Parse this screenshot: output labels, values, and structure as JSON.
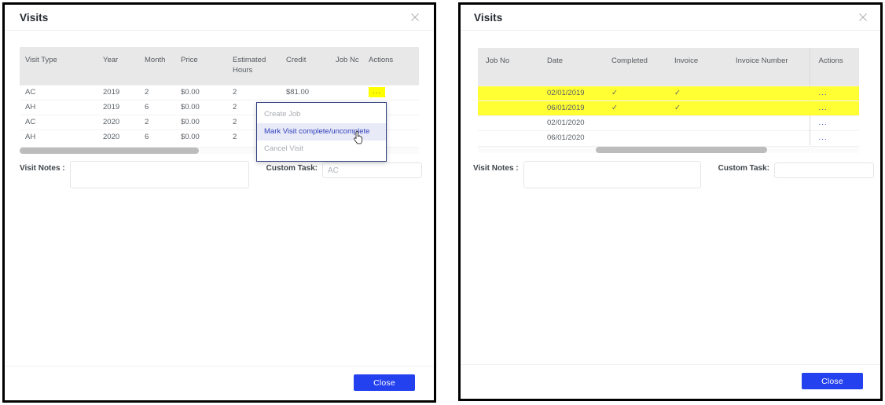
{
  "left_dialog": {
    "title": "Visits",
    "close_icon": "close-x-icon",
    "grid": {
      "headers": [
        "Visit Type",
        "Year",
        "Month",
        "Price",
        "Estimated Hours",
        "Credit",
        "Job No",
        "Actions"
      ],
      "header_job_no_clipped": "Job Nc",
      "rows": [
        {
          "visit_type": "AC",
          "year": "2019",
          "month": "2",
          "price": "$0.00",
          "estimated_hours": "2",
          "credit": "$81.00",
          "job_no": "",
          "actions": "..."
        },
        {
          "visit_type": "AH",
          "year": "2019",
          "month": "6",
          "price": "$0.00",
          "estimated_hours": "2",
          "credit": "",
          "job_no": "",
          "actions": "..."
        },
        {
          "visit_type": "AC",
          "year": "2020",
          "month": "2",
          "price": "$0.00",
          "estimated_hours": "2",
          "credit": "",
          "job_no": "",
          "actions": "..."
        },
        {
          "visit_type": "AH",
          "year": "2020",
          "month": "6",
          "price": "$0.00",
          "estimated_hours": "2",
          "credit": "",
          "job_no": "",
          "actions": "..."
        }
      ]
    },
    "context_menu": {
      "items": [
        {
          "label": "Create Job",
          "enabled": false
        },
        {
          "label": "Mark Visit complete/uncomplete",
          "enabled": true
        },
        {
          "label": "Cancel Visit",
          "enabled": false
        }
      ]
    },
    "visit_notes_label": "Visit Notes :",
    "visit_notes_value": "",
    "custom_task_label": "Custom Task:",
    "custom_task_value": "",
    "custom_task_placeholder": "AC",
    "close_button": "Close"
  },
  "right_dialog": {
    "title": "Visits",
    "close_icon": "close-x-icon",
    "grid": {
      "headers": [
        "Job No",
        "Date",
        "Completed",
        "Invoice",
        "Invoice Number",
        "Actions"
      ],
      "rows": [
        {
          "job_no": "",
          "date": "02/01/2019",
          "completed": "✓",
          "invoice": "✓",
          "invoice_number": "",
          "actions": "...",
          "highlighted": true
        },
        {
          "job_no": "",
          "date": "06/01/2019",
          "completed": "✓",
          "invoice": "✓",
          "invoice_number": "",
          "actions": "...",
          "highlighted": true
        },
        {
          "job_no": "",
          "date": "02/01/2020",
          "completed": "",
          "invoice": "",
          "invoice_number": "",
          "actions": "...",
          "highlighted": false
        },
        {
          "job_no": "",
          "date": "06/01/2020",
          "completed": "",
          "invoice": "",
          "invoice_number": "",
          "actions": "...",
          "highlighted": false
        }
      ]
    },
    "visit_notes_label": "Visit Notes :",
    "visit_notes_value": "",
    "custom_task_label": "Custom Task:",
    "custom_task_value": "",
    "custom_task_placeholder": "",
    "close_button": "Close"
  },
  "colors": {
    "accent_blue": "#2441f0",
    "menu_highlight_text": "#2f3fb8",
    "menu_highlight_bg": "#e8eaf8",
    "row_highlight_yellow": "#ffff33",
    "action_yellow": "#ffff00",
    "header_grey": "#e8e8e8",
    "frame_black": "#000000"
  }
}
